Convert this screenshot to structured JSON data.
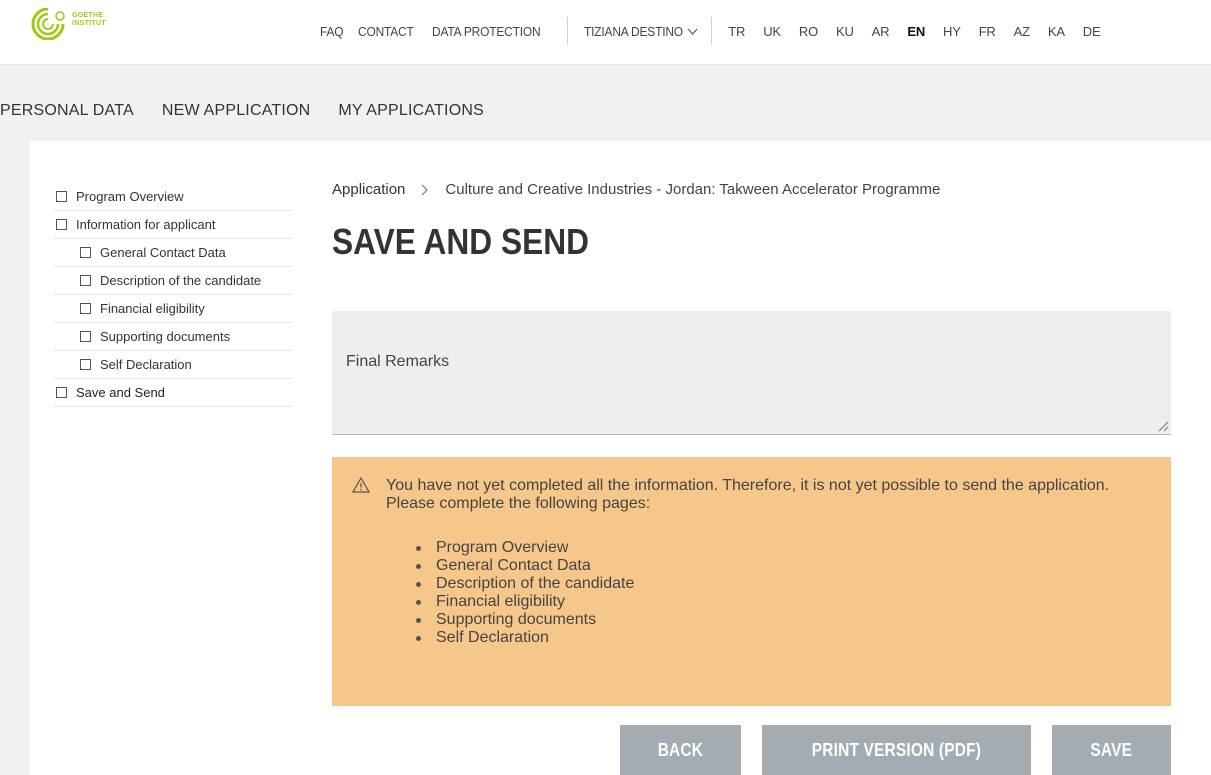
{
  "header": {
    "logo_text": [
      "GOETHE",
      "INSTITUT"
    ],
    "nav_links": [
      "FAQ",
      "CONTACT",
      "DATA PROTECTION"
    ],
    "user_name": "TIZIANA DESTINO",
    "languages": [
      "TR",
      "UK",
      "RO",
      "KU",
      "AR",
      "EN",
      "HY",
      "FR",
      "AZ",
      "KA",
      "DE"
    ],
    "active_language": "EN",
    "brand_color": "#a0c814"
  },
  "tabs": [
    "PERSONAL DATA",
    "NEW APPLICATION",
    "MY APPLICATIONS"
  ],
  "sidebar": {
    "items": [
      {
        "label": "Program Overview",
        "level": 0
      },
      {
        "label": "Information for applicant",
        "level": 0
      },
      {
        "label": "General Contact Data",
        "level": 1
      },
      {
        "label": "Description of the candidate",
        "level": 1
      },
      {
        "label": "Financial eligibility",
        "level": 1
      },
      {
        "label": "Supporting documents",
        "level": 1
      },
      {
        "label": "Self Declaration",
        "level": 1
      },
      {
        "label": "Save and Send",
        "level": 0
      }
    ]
  },
  "breadcrumb": {
    "root": "Application",
    "current": "Culture and Creative Industries - Jordan: Takween Accelerator Programme"
  },
  "page_title": "SAVE AND SEND",
  "remarks": {
    "placeholder": "Final Remarks"
  },
  "warning": {
    "message": "You have not yet completed all the information. Therefore, it is not yet possible to send the application. Please complete the following pages:",
    "pages": [
      "Program Overview",
      "General Contact Data",
      "Description of the candidate",
      "Financial eligibility",
      "Supporting documents",
      "Self Declaration"
    ],
    "background_color": "#f6c78b"
  },
  "buttons": {
    "back": "BACK",
    "print": "PRINT VERSION (PDF)",
    "save": "SAVE",
    "color": "#a5acb1"
  }
}
